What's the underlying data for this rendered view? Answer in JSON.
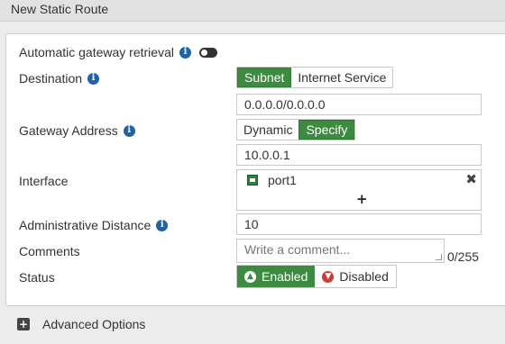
{
  "window": {
    "title": "New Static Route"
  },
  "form": {
    "auto_gateway": {
      "label": "Automatic gateway retrieval",
      "info_icon": "info-icon",
      "toggle_state": "off"
    },
    "destination": {
      "label": "Destination",
      "options": [
        "Subnet",
        "Internet Service"
      ],
      "selected": "Subnet",
      "value": "0.0.0.0/0.0.0.0"
    },
    "gateway": {
      "label": "Gateway Address",
      "options": [
        "Dynamic",
        "Specify"
      ],
      "selected": "Specify",
      "value": "10.0.0.1"
    },
    "interface": {
      "label": "Interface",
      "selected_port": "port1",
      "remove_symbol": "✖",
      "add_symbol": "+"
    },
    "admin_distance": {
      "label": "Administrative Distance",
      "value": "10"
    },
    "comments": {
      "label": "Comments",
      "placeholder": "Write a comment...",
      "counter": "0/255"
    },
    "status": {
      "label": "Status",
      "options": [
        "Enabled",
        "Disabled"
      ],
      "selected": "Enabled"
    }
  },
  "advanced": {
    "label": "Advanced Options",
    "expand_symbol": "+"
  },
  "colors": {
    "accent_green": "#3c8b41",
    "info_blue": "#1f63a7",
    "danger_red": "#cf3d32"
  }
}
